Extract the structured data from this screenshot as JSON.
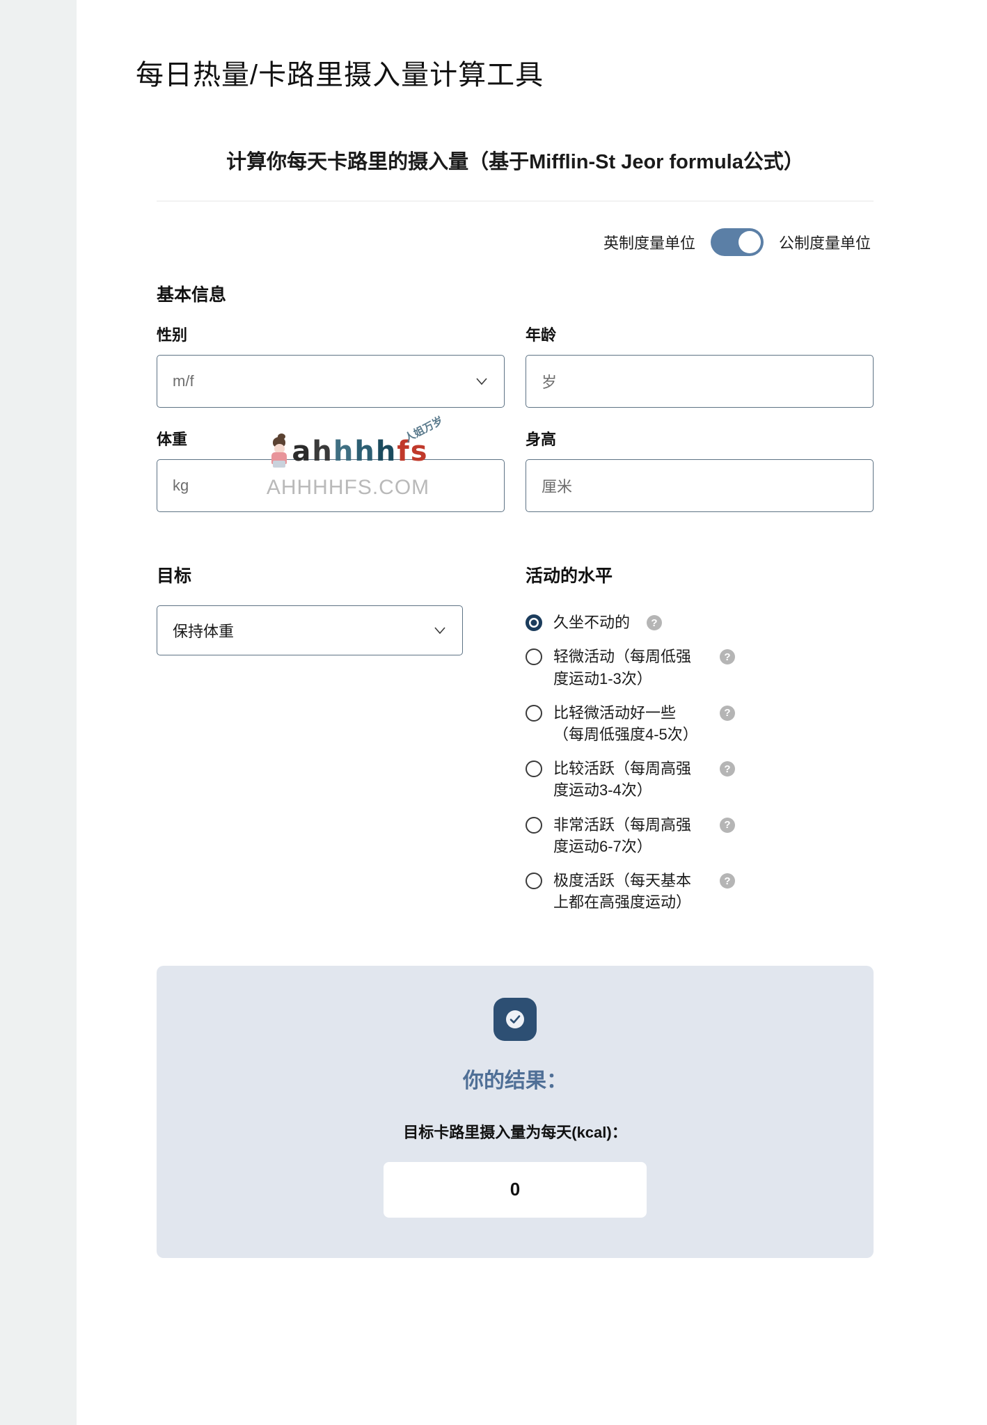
{
  "page": {
    "title": "每日热量/卡路里摄入量计算工具"
  },
  "calculator": {
    "subtitle": "计算你每天卡路里的摄入量（基于Mifflin-St Jeor formula公式）",
    "units": {
      "imperial_label": "英制度量单位",
      "metric_label": "公制度量单位",
      "active": "metric"
    },
    "basic_info": {
      "heading": "基本信息",
      "gender": {
        "label": "性别",
        "value": "m/f",
        "options": [
          "m/f"
        ]
      },
      "age": {
        "label": "年龄",
        "placeholder": "岁",
        "value": ""
      },
      "weight": {
        "label": "体重",
        "placeholder": "kg",
        "value": ""
      },
      "height": {
        "label": "身高",
        "placeholder": "厘米",
        "value": ""
      }
    },
    "goal": {
      "heading": "目标",
      "value": "保持体重",
      "options": [
        "保持体重"
      ]
    },
    "activity": {
      "heading": "活动的水平",
      "help_glyph": "?",
      "options": [
        {
          "label": "久坐不动的",
          "selected": true
        },
        {
          "label": "轻微活动（每周低强度运动1-3次）",
          "selected": false
        },
        {
          "label": "比轻微活动好一些（每周低强度4-5次）",
          "selected": false
        },
        {
          "label": "比较活跃（每周高强度运动3-4次）",
          "selected": false
        },
        {
          "label": "非常活跃（每周高强度运动6-7次）",
          "selected": false
        },
        {
          "label": "极度活跃（每天基本上都在高强度运动）",
          "selected": false
        }
      ]
    },
    "result": {
      "title": "你的结果：",
      "subtitle": "目标卡路里摄入量为每天(kcal)：",
      "value": "0"
    }
  },
  "watermark": {
    "letters": [
      "a",
      "h",
      "h",
      "h",
      "h",
      "f",
      "s"
    ],
    "badge": "人姐万岁",
    "domain": "AHHHHFS.COM"
  },
  "colors": {
    "accent": "#2d4f73",
    "toggle_on": "#5b7fa6",
    "result_bg": "#e1e6ee",
    "result_title": "#4f6f96",
    "border": "#5d7284"
  }
}
